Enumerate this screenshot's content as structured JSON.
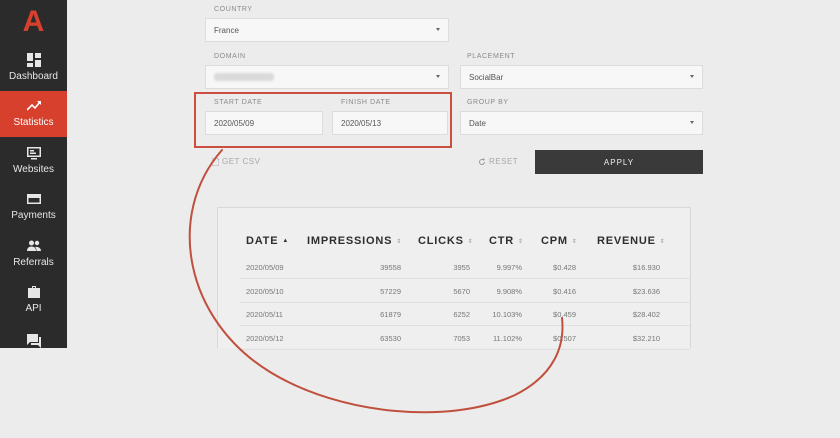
{
  "app": {
    "logo_letter": "A"
  },
  "sidebar": {
    "items": [
      {
        "label": "Dashboard",
        "icon": "dashboard-icon"
      },
      {
        "label": "Statistics",
        "icon": "trending-up-icon",
        "active": true
      },
      {
        "label": "Websites",
        "icon": "websites-icon"
      },
      {
        "label": "Payments",
        "icon": "payments-icon"
      },
      {
        "label": "Referrals",
        "icon": "referrals-icon"
      },
      {
        "label": "API",
        "icon": "briefcase-icon"
      },
      {
        "label": "",
        "icon": "chat-icon"
      }
    ]
  },
  "filters": {
    "country": {
      "label": "COUNTRY",
      "value": "France"
    },
    "domain": {
      "label": "DOMAIN",
      "value": ""
    },
    "placement": {
      "label": "PLACEMENT",
      "value": "SocialBar"
    },
    "start_date": {
      "label": "START DATE",
      "value": "2020/05/09"
    },
    "finish_date": {
      "label": "FINISH DATE",
      "value": "2020/05/13"
    },
    "group_by": {
      "label": "GROUP BY",
      "value": "Date"
    }
  },
  "actions": {
    "get_csv": "GET CSV",
    "reset": "RESET",
    "apply": "APPLY"
  },
  "table": {
    "columns": [
      "DATE",
      "IMPRESSIONS",
      "CLICKS",
      "CTR",
      "CPM",
      "REVENUE"
    ],
    "rows": [
      [
        "2020/05/09",
        "39558",
        "3955",
        "9.997%",
        "$0.428",
        "$16.930"
      ],
      [
        "2020/05/10",
        "57229",
        "5670",
        "9.908%",
        "$0.416",
        "$23.636"
      ],
      [
        "2020/05/11",
        "61879",
        "6252",
        "10.103%",
        "$0.459",
        "$28.402"
      ],
      [
        "2020/05/12",
        "63530",
        "7053",
        "11.102%",
        "$0.507",
        "$32.210"
      ]
    ]
  },
  "colors": {
    "accent": "#d6402c",
    "sidebar_bg": "#2b2b2b",
    "annotation": "#c9503e"
  }
}
